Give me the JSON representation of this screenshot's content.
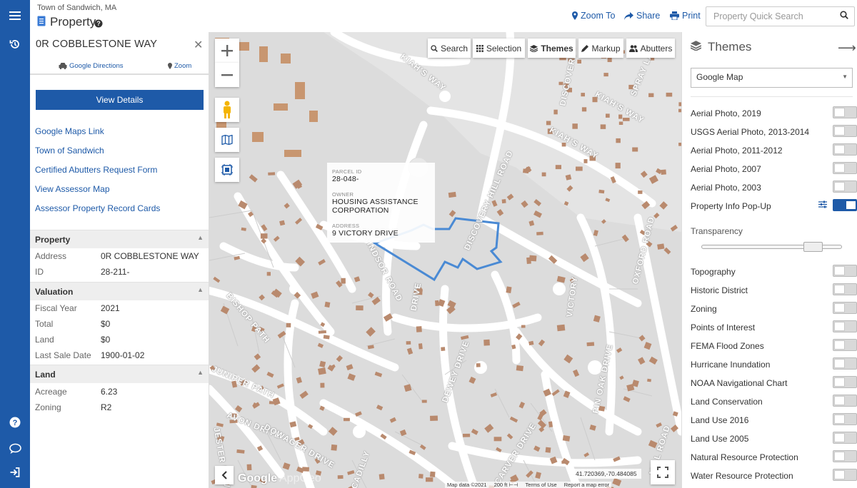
{
  "header": {
    "town": "Town of Sandwich, MA",
    "title": "Property",
    "zoom_to": "Zoom To",
    "share": "Share",
    "print": "Print",
    "search_placeholder": "Property Quick Search"
  },
  "panel": {
    "address": "0R COBBLESTONE WAY",
    "directions": "Google Directions",
    "zoom": "Zoom",
    "view_details": "View Details",
    "links": [
      "Google Maps Link",
      "Town of Sandwich",
      "Certified Abutters Request Form",
      "View Assessor Map",
      "Assessor Property Record Cards"
    ],
    "property": {
      "title": "Property",
      "address_label": "Address",
      "address_value": "0R COBBLESTONE WAY",
      "id_label": "ID",
      "id_value": "28-211-"
    },
    "valuation": {
      "title": "Valuation",
      "fiscal_label": "Fiscal Year",
      "fiscal_value": "2021",
      "total_label": "Total",
      "total_value": "$0",
      "land_label": "Land",
      "land_value": "$0",
      "sale_label": "Last Sale Date",
      "sale_value": "1900-01-02"
    },
    "land": {
      "title": "Land",
      "acreage_label": "Acreage",
      "acreage_value": "6.23",
      "zoning_label": "Zoning",
      "zoning_value": "R2"
    }
  },
  "map": {
    "toolbar": {
      "search": "Search",
      "selection": "Selection",
      "themes": "Themes",
      "markup": "Markup",
      "abutters": "Abutters"
    },
    "popup": {
      "parcel_label": "Parcel ID",
      "parcel_value": "28-048-",
      "owner_label": "Owner",
      "owner_value_1": "HOUSING ASSISTANCE",
      "owner_value_2": "CORPORATION",
      "address_label": "Address",
      "address_value": "9 VICTORY DRIVE"
    },
    "streets": {
      "kiahs1": "KIAH'S WAY",
      "kiahs2": "KIAH'S WAY",
      "kiahs3": "KIAH'S WAY",
      "discovery_hill": "DISCOVERY HILL ROAD",
      "discovery": "DISCOVERY",
      "spray_lane": "SPRAY LANE",
      "windsor": "WINDSOR ROAD",
      "bishop": "BISHOP PATH",
      "oxford": "OXFORD ROAD",
      "drive": "DRIVE",
      "victory": "VICTORY",
      "juniper": "JUNIPER PATH",
      "pin_oak": "PIN OAK DRIVE",
      "avon": "AVON DRIVE",
      "jester": "JESTER DRIVE",
      "dowager": "DOWAGER DRIVE",
      "carver": "CARVER DRIVE",
      "piccadilly": "PICCADILLY",
      "mill": "MILL ROAD",
      "dewey": "DEWEY DRIVE"
    },
    "coords": "41.720369,-70.484085",
    "logo": "Google",
    "logo_secondary": "AppGeo",
    "attrib_data": "Map data ©2021",
    "attrib_scale": "200 ft",
    "attrib_terms": "Terms of Use",
    "attrib_report": "Report a map error"
  },
  "themes": {
    "title": "Themes",
    "basemap": "Google Map",
    "transparency": "Transparency",
    "layers_top": [
      {
        "name": "Aerial Photo, 2019",
        "on": false
      },
      {
        "name": "USGS Aerial Photo, 2013-2014",
        "on": false
      },
      {
        "name": "Aerial Photo, 2011-2012",
        "on": false
      },
      {
        "name": "Aerial Photo, 2007",
        "on": false
      },
      {
        "name": "Aerial Photo, 2003",
        "on": false
      },
      {
        "name": "Property Info Pop-Up",
        "on": true
      }
    ],
    "layers_bottom": [
      {
        "name": "Topography",
        "on": false
      },
      {
        "name": "Historic District",
        "on": false
      },
      {
        "name": "Zoning",
        "on": false
      },
      {
        "name": "Points of Interest",
        "on": false
      },
      {
        "name": "FEMA Flood Zones",
        "on": false
      },
      {
        "name": "Hurricane Inundation",
        "on": false
      },
      {
        "name": "NOAA Navigational Chart",
        "on": false
      },
      {
        "name": "Land Conservation",
        "on": false
      },
      {
        "name": "Land Use 2016",
        "on": false
      },
      {
        "name": "Land Use 2005",
        "on": false
      },
      {
        "name": "Natural Resource Protection",
        "on": false
      },
      {
        "name": "Water Resource Protection",
        "on": false
      }
    ]
  },
  "colors": {
    "brand": "#1e5aa8",
    "parcel_outline": "#4a8ad4"
  }
}
